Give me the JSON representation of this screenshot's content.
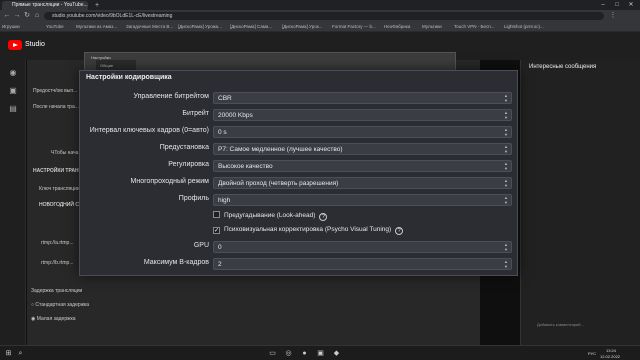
{
  "browser": {
    "tab_active": "Прямые трансляции - YouTube...",
    "tab_new": "+",
    "url": "studio.youtube.com/video/9bOLdE1L-cE/livestreaming",
    "bookmarks": [
      "Игрушки",
      "YouTube",
      "Мультики из Амаз...",
      "Загадочные Места В...",
      "[ДискоРама] Урожа...",
      "[ДискоРама] Сама...",
      "[ДискоРама] Урок...",
      "Format Factory — b...",
      "НеоФабрика",
      "Мультики",
      "Touch VPN - Бесп...",
      "Lightshot (prnt.sc)..."
    ],
    "win_min": "–",
    "win_max": "□",
    "win_close": "✕"
  },
  "studio": {
    "label": "Studio",
    "left_texts": [
      "Предостч/ом вып...",
      "После начала тра...",
      "ЧТобы нача...",
      "НАСТРОЙКИ ТРАН..."
    ],
    "stream_key_label": "Ключ трансляции...",
    "stream_key_value": "НОВОГОДНИЙ С...",
    "rtmp1": "rtmp://a.rtmp...",
    "rtmp2": "rtmp://b.rtmp...",
    "latency_label": "Задержка трансляции",
    "latency_opt1": "Стандартная задержка",
    "latency_opt2": "Малая задержка"
  },
  "chat": {
    "title": "Интересные сообщения",
    "comment_placeholder": "Добавить комментарий..."
  },
  "obs": {
    "back_title": "Настройки",
    "back_tab": "Общие"
  },
  "dialog": {
    "title": "Настройки кодировщика",
    "rows": [
      {
        "label": "Управление битрейтом",
        "value": "CBR"
      },
      {
        "label": "Битрейт",
        "value": "20000 Kbps"
      },
      {
        "label": "Интервал ключевых кадров (0=авто)",
        "value": "0 s"
      },
      {
        "label": "Предустановка",
        "value": "P7: Самое медленное (лучшее качество)"
      },
      {
        "label": "Регулировка",
        "value": "Высокое качество"
      },
      {
        "label": "Многопроходный режим",
        "value": "Двойной проход (четверть разрешения)"
      },
      {
        "label": "Профиль",
        "value": "high"
      }
    ],
    "check_lookahead": "Предугадывание (Look-ahead)",
    "check_lookahead_checked": false,
    "check_psycho": "Психовизуальная корректировка (Psycho Visual Tuning)",
    "check_psycho_checked": true,
    "gpu_label": "GPU",
    "gpu_value": "0",
    "bframes_label": "Максимум B-кадров",
    "bframes_value": "2",
    "help_glyph": "?"
  },
  "taskbar": {
    "lang": "РУС",
    "time": "13:24",
    "date": "12.02.2022"
  }
}
